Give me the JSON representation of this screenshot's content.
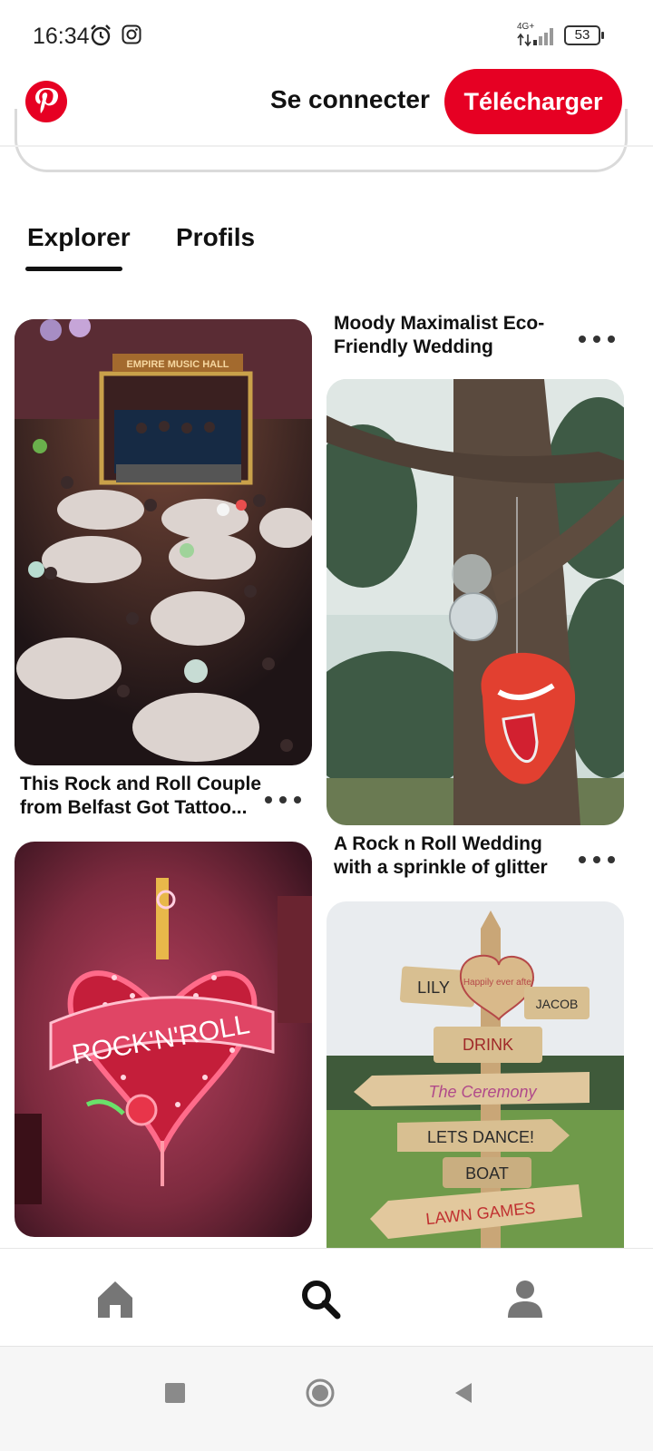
{
  "status_bar": {
    "time": "16:34",
    "network": "4G+",
    "battery": "53"
  },
  "header": {
    "login_label": "Se connecter",
    "download_label": "Télécharger"
  },
  "tabs": [
    {
      "label": "Explorer",
      "active": true
    },
    {
      "label": "Profils",
      "active": false
    }
  ],
  "pins": {
    "left": [
      {
        "title": "This Rock and Roll Couple from Belfast Got Tattoo..."
      },
      {
        "title": ""
      }
    ],
    "right": [
      {
        "title": "Moody Maximalist Eco-Friendly Wedding"
      },
      {
        "title": "A Rock n Roll Wedding with a sprinkle of glitter"
      }
    ],
    "image_text": {
      "music_hall_sign": "EMPIRE MUSIC HALL",
      "neon": "ROCK'N'ROLL",
      "sign_lily": "LILY",
      "sign_jacob": "JACOB",
      "sign_happy": "Happily ever after",
      "sign_drink": "DRINK",
      "sign_ceremony": "The Ceremony",
      "sign_dance": "LETS DANCE!",
      "sign_boat": "BOAT",
      "sign_lawn": "LAWN GAMES"
    }
  },
  "colors": {
    "brand": "#e60023",
    "text": "#111111"
  },
  "nav": {
    "home_icon": "home-icon",
    "search_icon": "search-icon",
    "profile_icon": "profile-icon"
  }
}
